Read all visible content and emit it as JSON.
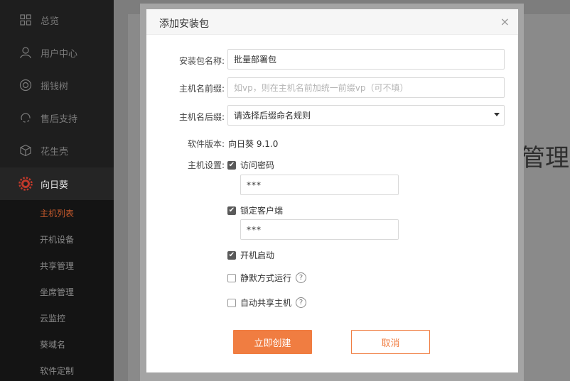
{
  "sidebar": {
    "items": [
      {
        "label": "总览",
        "icon": "grid-icon"
      },
      {
        "label": "用户中心",
        "icon": "user-icon"
      },
      {
        "label": "摇钱树",
        "icon": "target-icon"
      },
      {
        "label": "售后支持",
        "icon": "support-icon"
      },
      {
        "label": "花生壳",
        "icon": "cube-icon"
      },
      {
        "label": "向日葵",
        "icon": "sunflower-icon"
      }
    ],
    "subitems": [
      "主机列表",
      "开机设备",
      "共享管理",
      "坐席管理",
      "云监控",
      "葵域名",
      "软件定制"
    ]
  },
  "background": {
    "title_fragment": "管理"
  },
  "modal": {
    "title": "添加安装包",
    "close_symbol": "×",
    "fields": {
      "package_name": {
        "label": "安装包名称:",
        "value": "批量部署包"
      },
      "host_prefix": {
        "label": "主机名前缀:",
        "placeholder": "如vp，则在主机名前加统一前缀vp（可不填）"
      },
      "host_suffix": {
        "label": "主机名后缀:",
        "value": "请选择后缀命名规则"
      },
      "software_version": {
        "label": "软件版本:",
        "value": "向日葵 9.1.0"
      },
      "host_settings": {
        "label": "主机设置:"
      }
    },
    "options": {
      "access_password": {
        "label": "访问密码",
        "checked": true,
        "password": "***"
      },
      "lock_client": {
        "label": "锁定客户端",
        "checked": true,
        "password": "***"
      },
      "auto_start": {
        "label": "开机启动",
        "checked": true
      },
      "silent_run": {
        "label": "静默方式运行",
        "checked": false
      },
      "auto_share": {
        "label": "自动共享主机",
        "checked": false
      }
    },
    "help_symbol": "?",
    "buttons": {
      "create": "立即创建",
      "cancel": "取消"
    }
  },
  "colors": {
    "accent": "#f07d41",
    "sidebar_bg": "#1e1e1e",
    "sidebar_active_sub": "#c75a2c"
  }
}
